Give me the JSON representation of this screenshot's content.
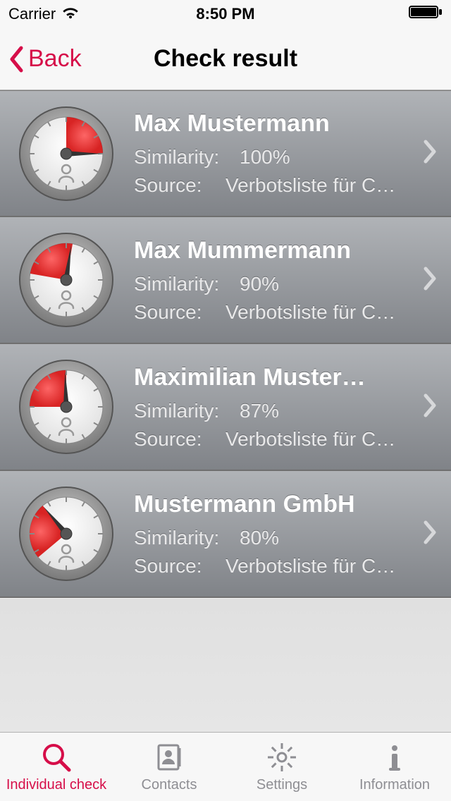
{
  "status": {
    "carrier": "Carrier",
    "time": "8:50 PM"
  },
  "nav": {
    "back": "Back",
    "title": "Check result"
  },
  "labels": {
    "similarity": "Similarity:",
    "source": "Source:"
  },
  "results": [
    {
      "name": "Max Mustermann",
      "similarity": "100%",
      "source": "Verbotsliste für C…",
      "needle_angle": 90,
      "fill_show": true,
      "fill_rot": 0
    },
    {
      "name": "Max Mummermann",
      "similarity": "90%",
      "source": "Verbotsliste für C…",
      "needle_angle": 8,
      "fill_show": true,
      "fill_rot": -80
    },
    {
      "name": "Maximilian Muster…",
      "similarity": "87%",
      "source": "Verbotsliste für C…",
      "needle_angle": -2,
      "fill_show": true,
      "fill_rot": -90
    },
    {
      "name": "Mustermann GmbH",
      "similarity": "80%",
      "source": "Verbotsliste für C…",
      "needle_angle": -40,
      "fill_show": true,
      "fill_rot": -130
    }
  ],
  "tabs": [
    {
      "id": "individual-check",
      "label": "Individual check",
      "active": true
    },
    {
      "id": "contacts",
      "label": "Contacts",
      "active": false
    },
    {
      "id": "settings",
      "label": "Settings",
      "active": false
    },
    {
      "id": "information",
      "label": "Information",
      "active": false
    }
  ]
}
